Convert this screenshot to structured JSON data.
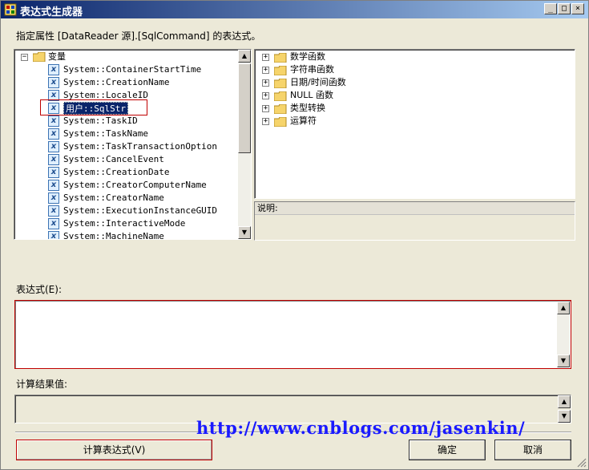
{
  "window": {
    "title": "表达式生成器",
    "min_glyph": "_",
    "max_glyph": "□",
    "close_glyph": "×"
  },
  "prompt": "指定属性 [DataReader 源].[SqlCommand] 的表达式。",
  "left_tree": {
    "root": "变量",
    "items": [
      "System::ContainerStartTime",
      "System::CreationName",
      "System::LocaleID",
      "用户::SqlStr",
      "System::TaskID",
      "System::TaskName",
      "System::TaskTransactionOption",
      "System::CancelEvent",
      "System::CreationDate",
      "System::CreatorComputerName",
      "System::CreatorName",
      "System::ExecutionInstanceGUID",
      "System::InteractiveMode",
      "System::MachineName"
    ],
    "selected_index": 3
  },
  "right_tree": {
    "items": [
      "数学函数",
      "字符串函数",
      "日期/时间函数",
      "NULL 函数",
      "类型转换",
      "运算符"
    ]
  },
  "description_label": "说明:",
  "expression_label": "表达式(E):",
  "expression_value": "",
  "result_label": "计算结果值:",
  "result_value": "",
  "watermark": "http://www.cnblogs.com/jasenkin/",
  "buttons": {
    "evaluate": "计算表达式(V)",
    "ok": "确定",
    "cancel": "取消"
  },
  "colors": {
    "title_start": "#0a246a",
    "title_end": "#a6caf0",
    "highlight_border": "#c00000",
    "watermark": "#1a1aff"
  }
}
